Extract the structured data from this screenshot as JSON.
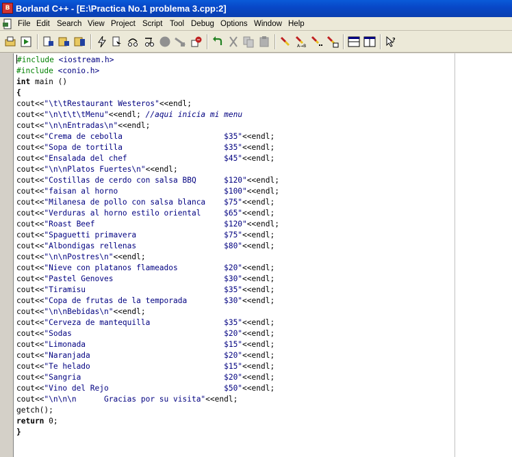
{
  "window": {
    "title": "Borland C++ - [E:\\Practica No.1 problema 3.cpp:2]"
  },
  "menu": [
    "File",
    "Edit",
    "Search",
    "View",
    "Project",
    "Script",
    "Tool",
    "Debug",
    "Options",
    "Window",
    "Help"
  ],
  "toolbar": {
    "buttons": [
      "open-project-icon",
      "run-icon",
      "save-icon",
      "save-all-icon",
      "make-icon",
      "build-icon",
      "compile-icon",
      "step-over-icon",
      "trace-into-icon",
      "stop-icon",
      "toggle-breakpoint-icon",
      "debug-run-icon",
      "undo-icon",
      "cut-icon",
      "copy-icon",
      "paste-icon",
      "search-icon",
      "edit-marker-icon",
      "marker-ab-icon",
      "marker-next-icon",
      "marker-list-icon",
      "tile-horizontal-icon",
      "tile-vertical-icon",
      "help-pointer-icon"
    ]
  },
  "code": [
    [
      "#include ",
      "<iostream.h>",
      "",
      ""
    ],
    [
      "#include ",
      "<conio.h>",
      "",
      ""
    ],
    [
      "",
      "",
      "int",
      " main ()"
    ],
    [
      "{"
    ],
    [
      "cout<<",
      "\"\\t\\tRestaurant Westeros\"",
      "<<endl;"
    ],
    [
      "cout<<",
      "\"\\n\\t\\t\\tMenu\"",
      "<<endl; ",
      "//aqui inicia mi menu"
    ],
    [
      "cout<<",
      "\"\\n\\nEntradas\\n\"",
      "<<endl;"
    ],
    [
      "cout<<",
      "\"Crema de cebolla                      $35\"",
      "<<endl;"
    ],
    [
      "cout<<",
      "\"Sopa de tortilla                      $35\"",
      "<<endl;"
    ],
    [
      "cout<<",
      "\"Ensalada del chef                     $45\"",
      "<<endl;"
    ],
    [
      "cout<<",
      "\"\\n\\nPlatos Fuertes\\n\"",
      "<<endl;"
    ],
    [
      "cout<<",
      "\"Costillas de cerdo con salsa BBQ      $120\"",
      "<<endl;"
    ],
    [
      "cout<<",
      "\"faisan al horno                       $100\"",
      "<<endl;"
    ],
    [
      "cout<<",
      "\"Milanesa de pollo con salsa blanca    $75\"",
      "<<endl;"
    ],
    [
      "cout<<",
      "\"Verduras al horno estilo oriental     $65\"",
      "<<endl;"
    ],
    [
      "cout<<",
      "\"Roast Beef                            $120\"",
      "<<endl;"
    ],
    [
      "cout<<",
      "\"Spaguetti primavera                   $75\"",
      "<<endl;"
    ],
    [
      "cout<<",
      "\"Albondigas rellenas                   $80\"",
      "<<endl;"
    ],
    [
      "cout<<",
      "\"\\n\\nPostres\\n\"",
      "<<endl;"
    ],
    [
      "cout<<",
      "\"Nieve con platanos flameados          $20\"",
      "<<endl;"
    ],
    [
      "cout<<",
      "\"Pastel Genoves                        $30\"",
      "<<endl;"
    ],
    [
      "cout<<",
      "\"Tiramisu                              $35\"",
      "<<endl;"
    ],
    [
      "cout<<",
      "\"Copa de frutas de la temporada        $30\"",
      "<<endl;"
    ],
    [
      "cout<<",
      "\"\\n\\nBebidas\\n\"",
      "<<endl;"
    ],
    [
      "cout<<",
      "\"Cerveza de mantequilla                $35\"",
      "<<endl;"
    ],
    [
      "cout<<",
      "\"Sodas                                 $20\"",
      "<<endl;"
    ],
    [
      "cout<<",
      "\"Limonada                              $15\"",
      "<<endl;"
    ],
    [
      "cout<<",
      "\"Naranjada                             $20\"",
      "<<endl;"
    ],
    [
      "cout<<",
      "\"Te helado                             $15\"",
      "<<endl;"
    ],
    [
      "cout<<",
      "\"Sangria                               $20\"",
      "<<endl;"
    ],
    [
      "cout<<",
      "\"Vino del Rejo                         $50\"",
      "<<endl;"
    ],
    [
      "cout<<",
      "\"\\n\\n\\n      Gracias por su visita\"",
      "<<endl;"
    ],
    [
      "getch();"
    ],
    [
      "",
      "",
      "return",
      " 0;"
    ],
    [
      "}"
    ]
  ],
  "colors": {
    "titlebar": "#0a4cc4",
    "keyword": "#000000",
    "string": "#000080",
    "preprocessor": "#008000"
  }
}
